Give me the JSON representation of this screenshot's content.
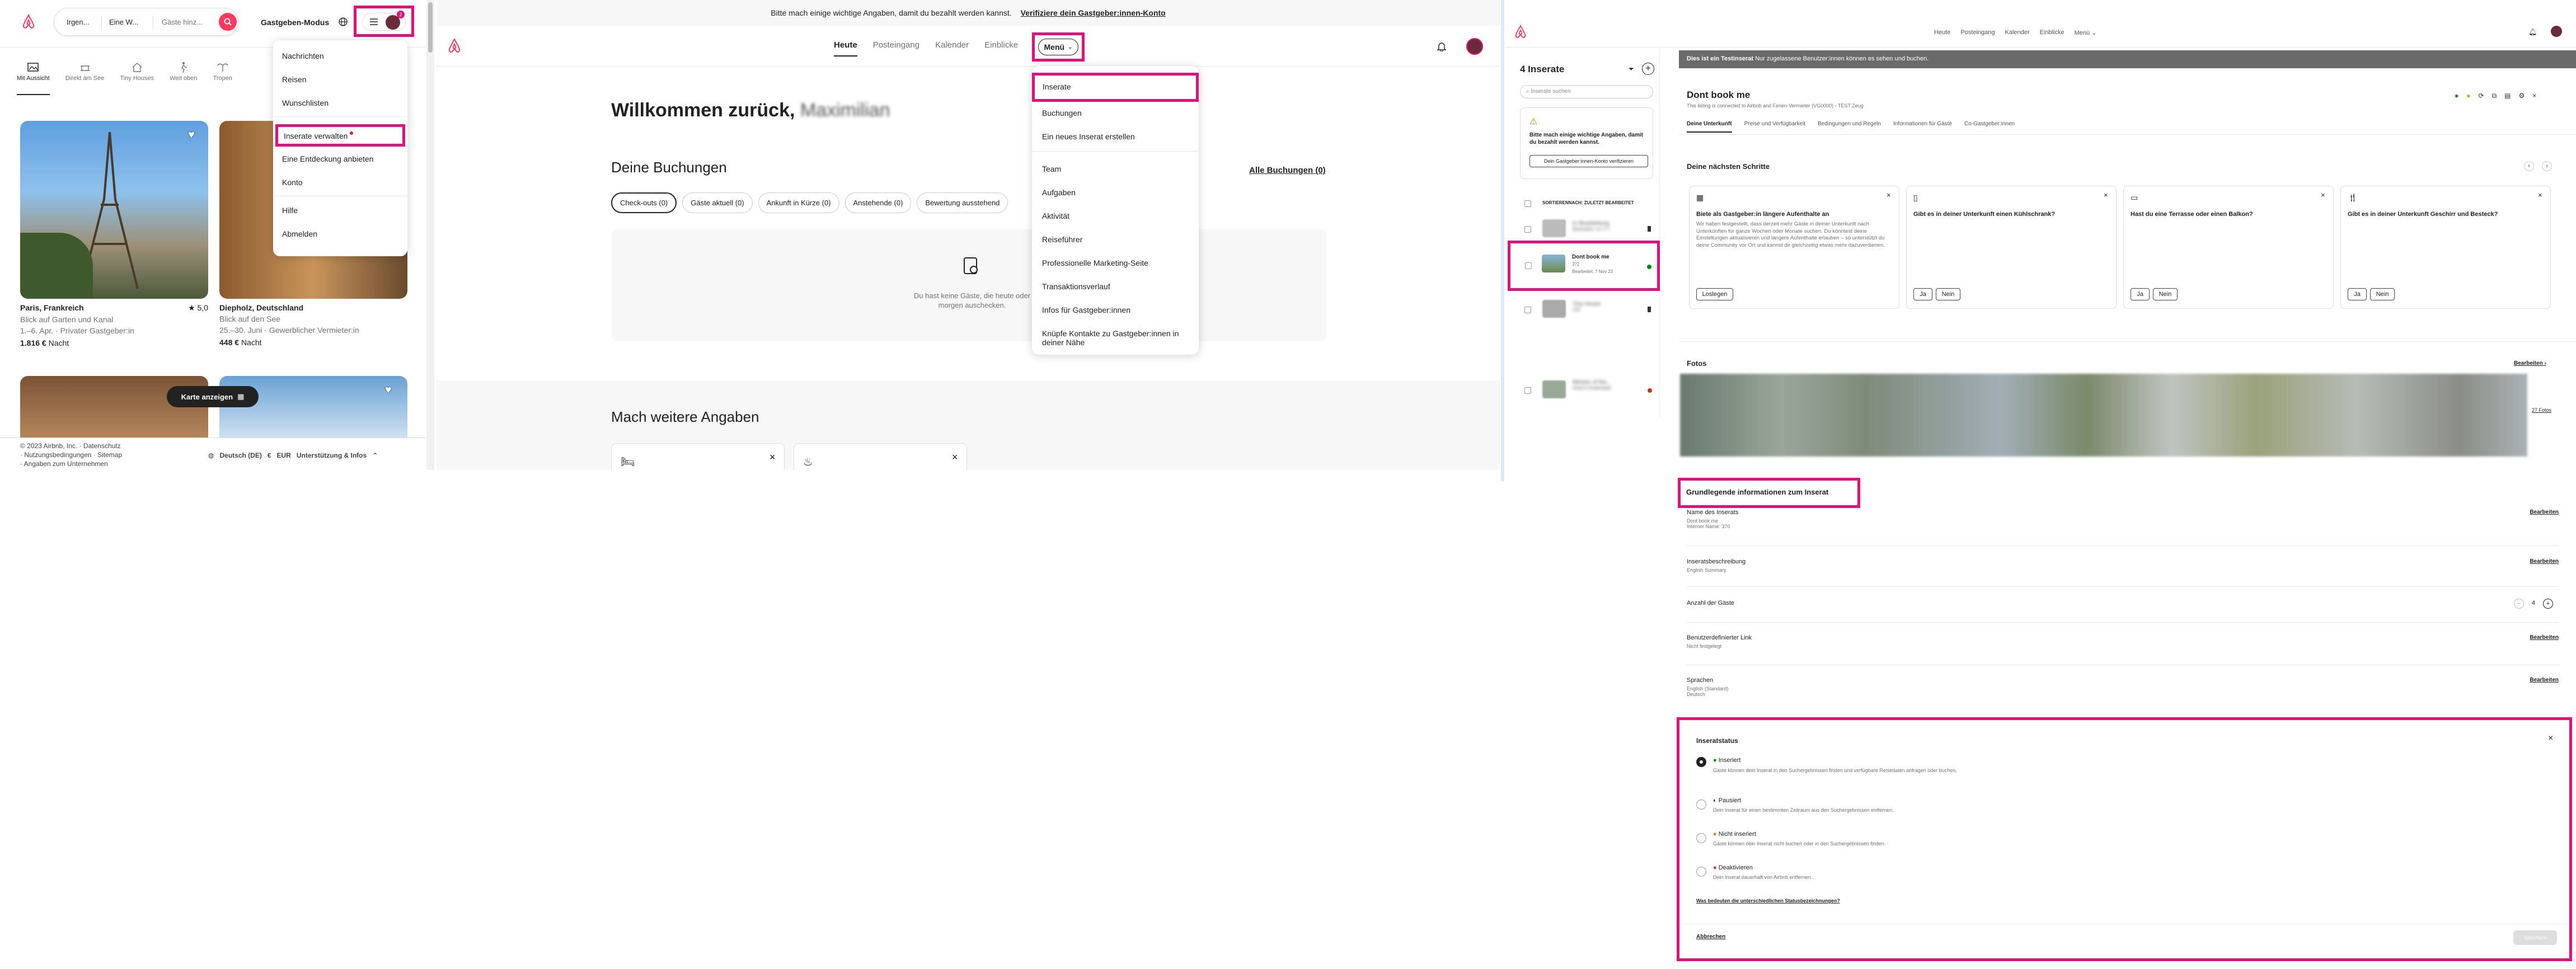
{
  "p1": {
    "search": {
      "where": "Irgen...",
      "when": "Eine W...",
      "who": "Gäste hinz..."
    },
    "host_mode_label": "Gastgeben-Modus",
    "notif_count": "2",
    "categories": [
      {
        "label": "Mit Aussicht",
        "icon": "mountain-view-icon"
      },
      {
        "label": "Direkt am See",
        "icon": "lake-icon"
      },
      {
        "label": "Tiny Houses",
        "icon": "tiny-house-icon"
      },
      {
        "label": "Weit oben",
        "icon": "hiking-icon"
      },
      {
        "label": "Tropen",
        "icon": "tropical-icon"
      }
    ],
    "listings": [
      {
        "title": "Paris, Frankreich",
        "rating": "5,0",
        "line1": "Blick auf Garten und Kanal",
        "line2": "1.–6. Apr. · Privater Gastgeber:in",
        "price": "1.816 €",
        "unit": "Nacht"
      },
      {
        "title": "Diepholz, Deutschland",
        "rating": "",
        "line1": "Blick auf den See",
        "line2": "25.–30. Juni · Gewerblicher Vermieter:in",
        "price": "448 €",
        "unit": "Nacht"
      }
    ],
    "map_button": "Karte anzeigen",
    "footer": {
      "copyright": "© 2023 Airbnb, Inc.",
      "links": [
        "Datenschutz",
        "Nutzungsbedingungen",
        "Sitemap",
        "Angaben zum Unternehmen"
      ],
      "language": "Deutsch (DE)",
      "currency": "EUR",
      "support": "Unterstützung & Infos"
    },
    "menu": [
      "Nachrichten",
      "Reisen",
      "Wunschlisten",
      "Inserate verwalten",
      "Eine Entdeckung anbieten",
      "Konto",
      "Hilfe",
      "Abmelden"
    ]
  },
  "p2": {
    "banner_text": "Bitte mach einige wichtige Angaben, damit du bezahlt werden kannst.",
    "banner_link": "Verifiziere dein Gastgeber:innen-Konto",
    "nav": [
      "Heute",
      "Posteingang",
      "Kalender",
      "Einblicke"
    ],
    "menu_button": "Menü",
    "welcome": "Willkommen zurück,",
    "user_name": "Maximilian",
    "bookings_heading": "Deine Buchungen",
    "all_bookings": "Alle Buchungen (0)",
    "filters": [
      "Check-outs (0)",
      "Gäste aktuell (0)",
      "Ankunft in Kürze (0)",
      "Anstehende (0)",
      "Bewertung ausstehend"
    ],
    "empty_text": "Du hast keine Gäste, die heute oder morgen auschecken.",
    "more_heading": "Mach weitere Angaben",
    "menu": [
      "Inserate",
      "Buchungen",
      "Ein neues Inserat erstellen",
      "Team",
      "Aufgaben",
      "Aktivität",
      "Reiseführer",
      "Professionelle Marketing-Seite",
      "Transaktionsverlauf",
      "Infos für Gastgeber:innen",
      "Knüpfe Kontakte zu Gastgeber:innen in deiner Nähe"
    ]
  },
  "p3": {
    "nav": [
      "Heute",
      "Posteingang",
      "Kalender",
      "Einblicke",
      "Menü"
    ],
    "listings_count": "4 Inserate",
    "search_placeholder": "Inserate suchen",
    "warning_text": "Bitte mach einige wichtige Angaben, damit du bezahlt werden kannst.",
    "verify_button": "Dein Gastgeber:innen-Konto verifizieren",
    "sort_label": "SORTIERENNACH: ZULETZT BEARBEITET",
    "listing_rows": [
      {
        "title": "In Bearbeitung",
        "sub": "Bearbeitet: vor 3 T.",
        "blur": true
      },
      {
        "title": "Dont book me",
        "sub": "372",
        "sub2": "Bearbeitet: 7 Nov 23",
        "blur": false
      },
      {
        "title": "Tiny House",
        "sub": "123",
        "sub2": "Bearbeitet",
        "blur": true
      },
      {
        "title": "Meister of the...",
        "sub": "Hotel in Duderstadt",
        "sub2": "Bearbeitet: 17 Aug 2023",
        "blur": true
      }
    ],
    "test_banner_bold": "Dies ist ein Testinserat",
    "test_banner_rest": "Nur zugelassene Benutzer:innen können es sehen und buchen.",
    "title": "Dont book me",
    "subtitle": "This listing is connected to Airbnb and Ferien-Vermieter (VG0000) - TEST Zeug",
    "tabs": [
      "Deine Unterkunft",
      "Preise und Verfügbarkeit",
      "Bedingungen und Regeln",
      "Informationen für Gäste",
      "Co-Gastgeber:innen"
    ],
    "next_steps_heading": "Deine nächsten Schritte",
    "cards": [
      {
        "title": "Biete als Gastgeber:in längere Aufenthalte an",
        "body": "Wir haben festgestellt, dass derzeit mehr Gäste in deiner Unterkunft nach Unterkünften für ganze Wochen oder Monate suchen. Du könntest deine Einstellungen aktualisieren und längere Aufenthalte erlauben – so unterstützt du deine Community vor Ort und kannst dir gleichzeitig etwas mehr dazuverdienen.",
        "buttons": [
          "Loslegen"
        ]
      },
      {
        "title": "Gibt es in deiner Unterkunft einen Kühlschrank?",
        "body": "",
        "buttons": [
          "Ja",
          "Nein"
        ]
      },
      {
        "title": "Hast du eine Terrasse oder einen Balkon?",
        "body": "",
        "buttons": [
          "Ja",
          "Nein"
        ]
      },
      {
        "title": "Gibt es in deiner Unterkunft Geschirr und Besteck?",
        "body": "",
        "buttons": [
          "Ja",
          "Nein"
        ]
      }
    ],
    "photos_heading": "Fotos",
    "edit_label": "Bearbeiten",
    "photos_count": "27 Fotos",
    "basic_heading": "Grundlegende informationen zum Inserat",
    "rows": [
      {
        "label": "Name des Inserats",
        "value1": "Dont book me",
        "value2": "Interner Name: 370"
      },
      {
        "label": "Inseratsbeschreibung",
        "value1": "English Summary",
        "value2": ""
      },
      {
        "label": "Benutzerdefinierter Link",
        "value1": "Nicht festgelegt",
        "value2": ""
      },
      {
        "label": "Sprachen",
        "value1": "English (Standard)",
        "value2": "Deutsch"
      }
    ],
    "guests_label": "Anzahl der Gäste",
    "guests_value": "4",
    "status_heading": "Inseratstatus",
    "status_options": [
      {
        "label": "Inseriert",
        "desc": "Gäste können dein Inserat in den Suchergebnissen finden und verfügbare Reisedaten anfragen oder buchen.",
        "color": "#008a05",
        "checked": true
      },
      {
        "label": "Pausiert",
        "desc": "Dein Inserat für einen bestimmten Zeitraum aus den Suchergebnissen entfernen.",
        "color": "#222222",
        "checked": false
      },
      {
        "label": "Nicht inseriert",
        "desc": "Gäste können dein Inserat nicht buchen oder in den Suchergebnissen finden.",
        "color": "#e07912",
        "checked": false
      },
      {
        "label": "Deaktivieren",
        "desc": "Dein Inserat dauerhaft von Airbnb entfernen.",
        "color": "#c13515",
        "checked": false
      }
    ],
    "status_link": "Was bedeuten die unterschiedlichen Statusbezeichnungen?",
    "cancel_label": "Abbrechen",
    "save_label": "Speichern"
  }
}
